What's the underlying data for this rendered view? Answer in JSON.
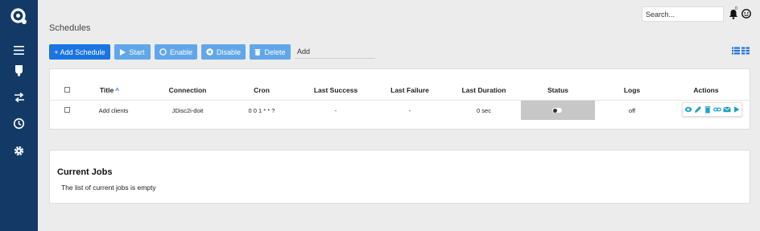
{
  "colors": {
    "sidebar": "#133a66",
    "primary": "#1a74e2",
    "light_button": "#62a6ea",
    "action_icon": "#1aa3c4",
    "status_cell": "#c7c7c7"
  },
  "sidebar": {
    "items": [
      {
        "icon": "menu-icon"
      },
      {
        "icon": "plugin-icon"
      },
      {
        "icon": "transfer-icon"
      },
      {
        "icon": "history-icon"
      },
      {
        "icon": "gear-icon"
      }
    ]
  },
  "topbar": {
    "search_placeholder": "Search...",
    "notification_count": "0"
  },
  "page": {
    "title": "Schedules"
  },
  "toolbar": {
    "add_schedule": "+ Add Schedule",
    "start": "Start",
    "enable": "Enable",
    "disable": "Disable",
    "delete": "Delete",
    "add_input_value": "Add"
  },
  "table": {
    "headers": {
      "title": "Title",
      "connection": "Connection",
      "cron": "Cron",
      "last_success": "Last Success",
      "last_failure": "Last Failure",
      "last_duration": "Last Duration",
      "status": "Status",
      "logs": "Logs",
      "actions": "Actions"
    },
    "sort_indicator": "^",
    "rows": [
      {
        "title": "Add clients",
        "connection": "JDisc2i-doit",
        "cron": "0 0 1 * * ?",
        "last_success": "-",
        "last_failure": "-",
        "last_duration": "0 sec",
        "status_enabled": false,
        "logs": "off",
        "actions": [
          "eye-icon",
          "pencil-icon",
          "trash-icon",
          "link-icon",
          "mail-icon",
          "play-icon"
        ]
      }
    ]
  },
  "current_jobs": {
    "title": "Current Jobs",
    "empty_message": "The list of current jobs is empty"
  }
}
